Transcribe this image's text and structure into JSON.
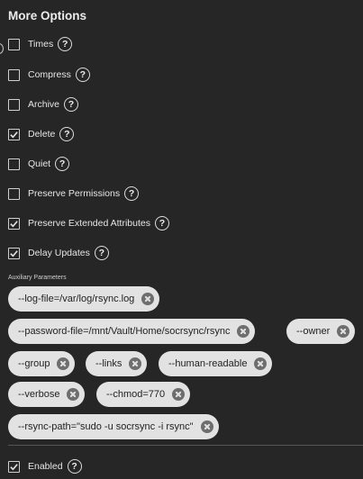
{
  "section_title": "More Options",
  "options": [
    {
      "key": "times",
      "label": "Times",
      "checked": false
    },
    {
      "key": "compress",
      "label": "Compress",
      "checked": false
    },
    {
      "key": "archive",
      "label": "Archive",
      "checked": false
    },
    {
      "key": "delete",
      "label": "Delete",
      "checked": true
    },
    {
      "key": "quiet",
      "label": "Quiet",
      "checked": false
    },
    {
      "key": "preserve-permissions",
      "label": "Preserve Permissions",
      "checked": false
    },
    {
      "key": "preserve-extended-attributes",
      "label": "Preserve Extended Attributes",
      "checked": true
    },
    {
      "key": "delay-updates",
      "label": "Delay Updates",
      "checked": true
    }
  ],
  "auxiliary": {
    "label": "Auxiliary Parameters",
    "chips": [
      "--log-file=/var/log/rsync.log",
      "--password-file=/mnt/Vault/Home/socrsync/rsync",
      "--owner",
      "--group",
      "--links",
      "--human-readable",
      "--verbose",
      "--chmod=770",
      "--rsync-path=\"sudo -u socrsync -i rsync\""
    ]
  },
  "enabled": {
    "label": "Enabled",
    "checked": true
  },
  "help_glyph": "?",
  "icons": {
    "help": "help-circle-icon",
    "check": "check-icon",
    "remove": "remove-circle-icon"
  }
}
